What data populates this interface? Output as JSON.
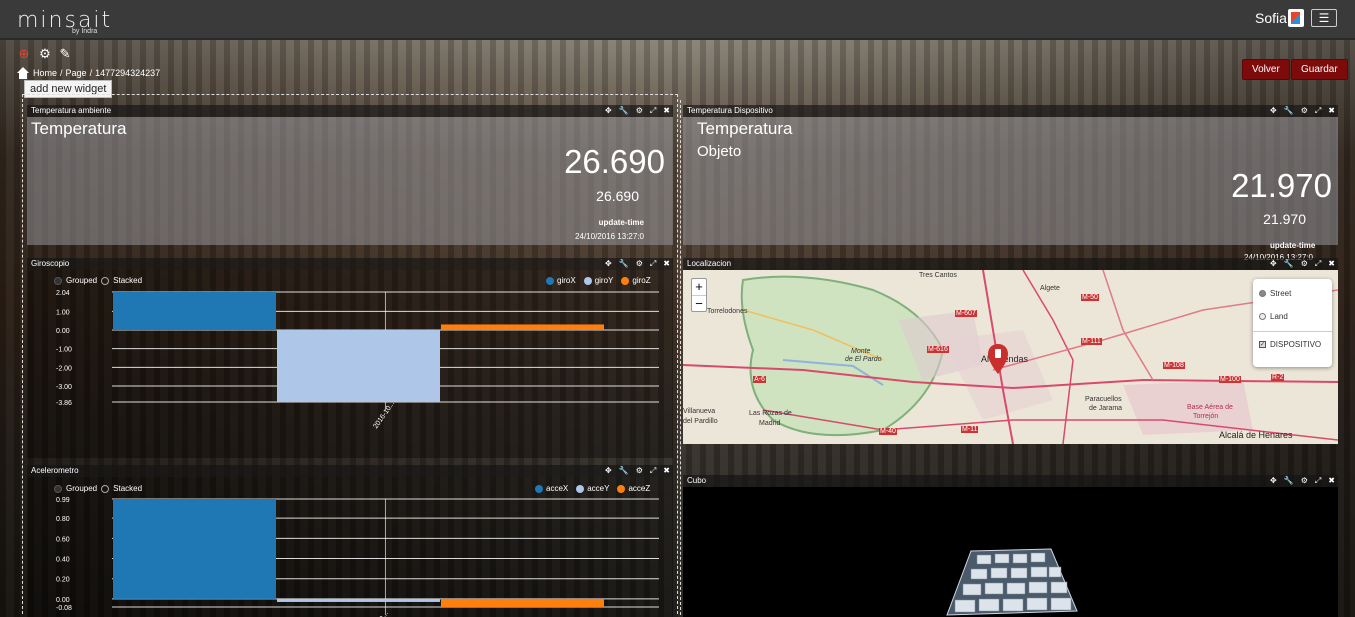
{
  "topbar": {
    "logo": "minsait",
    "logo_sub": "by Indra",
    "user": "Sofia",
    "menu_icon": "hamburger-icon"
  },
  "toolbar": {
    "tools": [
      "add-widget-icon",
      "settings-icon",
      "edit-icon"
    ],
    "tooltip": "add new widget"
  },
  "breadcrumb": {
    "home": "Home",
    "separator": "/",
    "page": "Page",
    "id": "1477294324237"
  },
  "actions": {
    "back_label": "Volver",
    "save_label": "Guardar"
  },
  "panel_controls": [
    "move-icon",
    "wrench-icon",
    "gear-icon",
    "expand-icon",
    "close-icon"
  ],
  "temp_ambiente": {
    "header": "Temperatura ambiente",
    "title": "Temperatura",
    "value": "26.690",
    "sub_value": "26.690",
    "update_label": "update-time",
    "update_value": "24/10/2016 13:27:0"
  },
  "temp_dispositivo": {
    "header": "Temperatura Dispositivo",
    "title": "Temperatura",
    "subtitle": "Objeto",
    "value": "21.970",
    "sub_value": "21.970",
    "update_label": "update-time",
    "update_value": "24/10/2016 13:27:0"
  },
  "giroscopio": {
    "header": "Giroscopio",
    "grouped": "Grouped",
    "stacked": "Stacked",
    "x_tick": "2016-10..."
  },
  "acelerometro": {
    "header": "Acelerometro",
    "grouped": "Grouped",
    "stacked": "Stacked",
    "x_tick": "2..."
  },
  "localizacion": {
    "header": "Localizacion",
    "zoom_in": "+",
    "zoom_out": "−",
    "layers": [
      "Street",
      "Land"
    ],
    "overlay": "DISPOSITIVO",
    "places": [
      {
        "name": "Tres Cantos",
        "size": "sm"
      },
      {
        "name": "Algete",
        "size": "sm"
      },
      {
        "name": "Torrelodones",
        "size": "sm"
      },
      {
        "name": "Monte",
        "size": "sm"
      },
      {
        "name": "de El Pardo",
        "size": "sm"
      },
      {
        "name": "Alcobendas",
        "size": "sm"
      },
      {
        "name": "Las Rozas de",
        "size": "sm"
      },
      {
        "name": "Madrid",
        "size": "sm"
      },
      {
        "name": "Paracuellos",
        "size": "sm"
      },
      {
        "name": "de Jarama",
        "size": "sm"
      },
      {
        "name": "Base Aérea de",
        "size": "sm"
      },
      {
        "name": "Torrejón",
        "size": "sm"
      },
      {
        "name": "Alcalá de Henares",
        "size": "md"
      },
      {
        "name": "Villanueva",
        "size": "sm"
      },
      {
        "name": "del Pardillo",
        "size": "sm"
      }
    ],
    "roads": [
      "M-607",
      "M-111",
      "M-50",
      "M-616",
      "M-40",
      "M-100",
      "M-108",
      "A-6",
      "M-11",
      "R-2"
    ],
    "marker_icon": "map-pin-icon"
  },
  "cubo": {
    "header": "Cubo"
  },
  "chart_data": [
    {
      "type": "bar",
      "title": "",
      "categories": [
        "2016-10..."
      ],
      "series": [
        {
          "name": "giroX",
          "values": [
            2.04
          ],
          "color": "#1f77b4"
        },
        {
          "name": "giroY",
          "values": [
            -3.86
          ],
          "color": "#aec7e8"
        },
        {
          "name": "giroZ",
          "values": [
            0.3
          ],
          "color": "#ff7f0e"
        }
      ],
      "y_ticks": [
        "2.04",
        "1.00",
        "0.00",
        "-1.00",
        "-2.00",
        "-3.00",
        "-3.86"
      ],
      "ylim": [
        -3.86,
        2.04
      ],
      "legend_position": "top-right",
      "grid": true
    },
    {
      "type": "bar",
      "title": "",
      "categories": [
        "2..."
      ],
      "series": [
        {
          "name": "acceX",
          "values": [
            0.99
          ],
          "color": "#1f77b4"
        },
        {
          "name": "acceY",
          "values": [
            -0.03
          ],
          "color": "#aec7e8"
        },
        {
          "name": "acceZ",
          "values": [
            -0.08
          ],
          "color": "#ff7f0e"
        }
      ],
      "y_ticks": [
        "0.99",
        "0.80",
        "0.60",
        "0.40",
        "0.20",
        "0.00",
        "-0.08"
      ],
      "ylim": [
        -0.08,
        0.99
      ],
      "legend_position": "top-right",
      "grid": true
    }
  ]
}
